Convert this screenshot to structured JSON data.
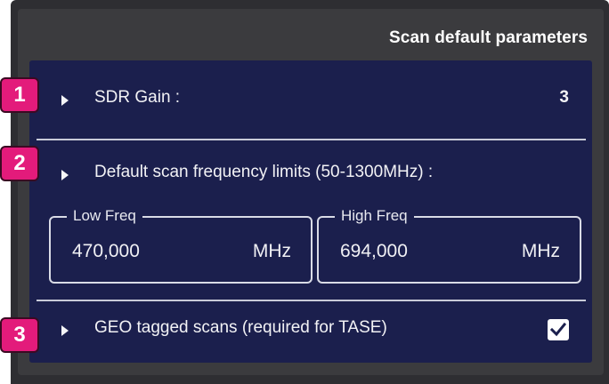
{
  "panel": {
    "title": "Scan default parameters"
  },
  "gain": {
    "label": "SDR Gain :",
    "value": "3"
  },
  "limits": {
    "label": "Default scan frequency limits (50-1300MHz) :",
    "low": {
      "legend": "Low Freq",
      "value": "470,000",
      "unit": "MHz"
    },
    "high": {
      "legend": "High Freq",
      "value": "694,000",
      "unit": "MHz"
    }
  },
  "geo": {
    "label": "GEO tagged scans (required for TASE)",
    "checked": true
  },
  "badges": [
    "1",
    "2",
    "3"
  ],
  "colors": {
    "panel_bg": "#3b3b3e",
    "content_bg": "#1b1f4d",
    "badge": "#e31b7b",
    "text": "#ffffff"
  },
  "icons": {
    "expand": "caret-right-icon",
    "check": "checkmark-icon"
  }
}
